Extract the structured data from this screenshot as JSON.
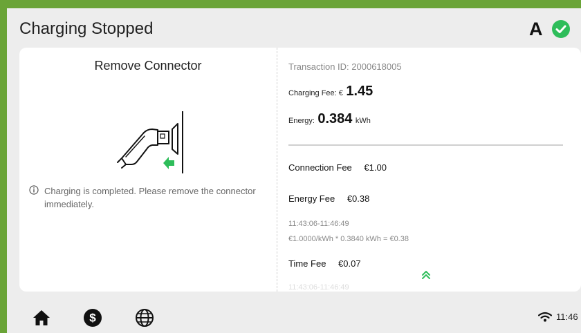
{
  "header": {
    "title": "Charging Stopped",
    "status_letter": "A",
    "status_icon": "check-circle-icon",
    "status_color": "#2ebd5a"
  },
  "left_panel": {
    "title": "Remove Connector",
    "illustration_icon": "unplug-connector-icon",
    "info_icon": "info-icon",
    "message": "Charging is completed. Please remove the connector immediately."
  },
  "right_panel": {
    "transaction_label": "Transaction ID: 2000618005",
    "charging_fee_label": "Charging Fee: €",
    "charging_fee_value": "1.45",
    "energy_label": "Energy:",
    "energy_value": "0.384",
    "energy_unit": "kWh",
    "fees": [
      {
        "label": "Connection Fee",
        "amount": "€1.00"
      },
      {
        "label": "Energy Fee",
        "amount": "€0.38",
        "time_range": "11:43:06-11:46:49",
        "formula": "€1.0000/kWh * 0.3840 kWh  =  €0.38"
      },
      {
        "label": "Time Fee",
        "amount": "€0.07",
        "time_range": "11:43:06-11:46:49"
      }
    ],
    "scroll_icon": "double-chevron-up-icon"
  },
  "bottom_bar": {
    "nav": [
      {
        "icon": "home-icon"
      },
      {
        "icon": "dollar-icon"
      },
      {
        "icon": "globe-icon"
      }
    ],
    "wifi_icon": "wifi-icon",
    "time": "11:46"
  },
  "colors": {
    "accent_green": "#2ebd5a",
    "frame_green": "#6aa437",
    "background": "#ededed"
  }
}
